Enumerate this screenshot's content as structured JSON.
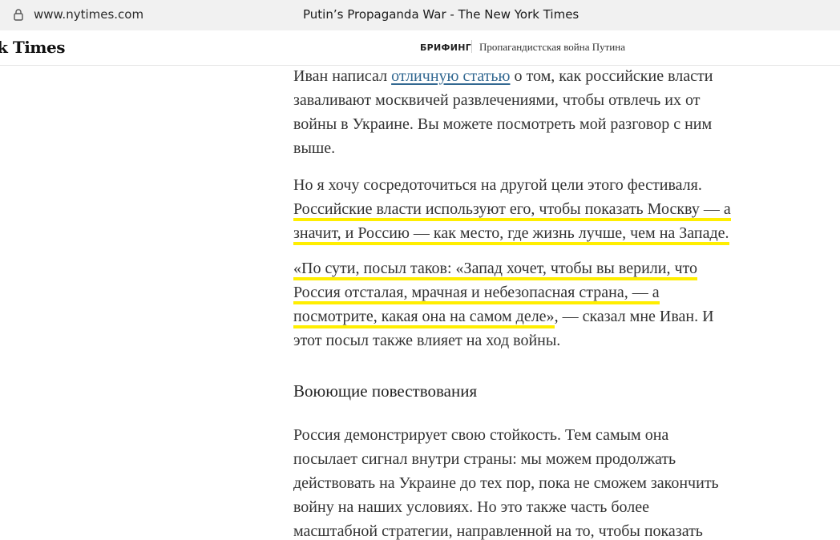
{
  "browser": {
    "url": "www.nytimes.com",
    "tab_title": "Putin’s Propaganda War - The New York Times"
  },
  "header": {
    "logo": "k Times",
    "section": "БРИФИНГ",
    "headline": "Пропагандистская война Путина"
  },
  "article": {
    "p1": {
      "before_link": "Иван написал ",
      "link": "отличную статью",
      "after_link_line1": " о том, как российские власти",
      "line2": "заваливают москвичей развлечениями, чтобы отвлечь их от",
      "line3": "войны в Украине. Вы можете посмотреть мой разговор с ним",
      "line4": "выше."
    },
    "p2": {
      "line1": "Но я хочу сосредоточиться на другой цели этого фестиваля.",
      "line2": "Российские власти используют его, чтобы показать Москву — а",
      "line3": "значит, и Россию — как место, где жизнь лучше, чем на Западе."
    },
    "p3": {
      "line1": "«По сути, посыл таков: «Запад хочет, чтобы вы верили, что",
      "line2": "Россия отсталая, мрачная и небезопасная страна, — а",
      "line3_hl": "посмотрите, какая она на самом деле»",
      "line3_rest": ", — сказал мне Иван. И",
      "line4": "этот посыл также влияет на ход войны."
    },
    "subhead": "Воюющие повествования",
    "p4": {
      "line1": "Россия демонстрирует свою стойкость. Тем самым она",
      "line2": "посылает сигнал внутри страны: мы можем продолжать",
      "line3": "действовать на Украине до тех пор, пока не сможем закончить",
      "line4": "войну на наших условиях. Но это также часть более",
      "line5": "масштабной стратегии, направленной на то, чтобы показать"
    }
  },
  "colors": {
    "highlight": "#ffee00",
    "link": "#326891"
  },
  "icons": {
    "lock": "lock-icon"
  }
}
